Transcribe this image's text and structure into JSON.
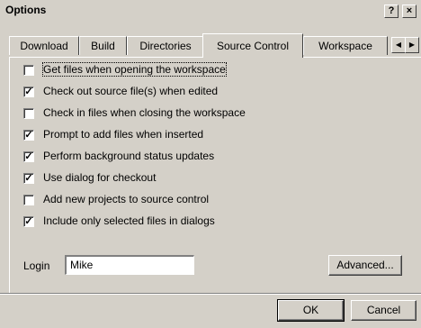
{
  "window": {
    "title": "Options"
  },
  "titlebar": {
    "help_label": "?",
    "close_label": "×"
  },
  "tabs": [
    {
      "label": "Download",
      "active": false
    },
    {
      "label": "Build",
      "active": false
    },
    {
      "label": "Directories",
      "active": false
    },
    {
      "label": "Source Control",
      "active": true
    },
    {
      "label": "Workspace",
      "active": false
    }
  ],
  "tab_scroll": {
    "left_icon": "◀",
    "right_icon": "▶"
  },
  "options": [
    {
      "label": "Get files when opening the workspace",
      "checked": false
    },
    {
      "label": "Check out source file(s) when edited",
      "checked": true
    },
    {
      "label": "Check in files when closing the workspace",
      "checked": false
    },
    {
      "label": "Prompt to add files when inserted",
      "checked": true
    },
    {
      "label": "Perform background status updates",
      "checked": true
    },
    {
      "label": "Use dialog for checkout",
      "checked": true
    },
    {
      "label": "Add new projects to source control",
      "checked": false
    },
    {
      "label": "Include only selected files in dialogs",
      "checked": true
    }
  ],
  "login": {
    "label": "Login",
    "value": "Mike"
  },
  "buttons": {
    "advanced": "Advanced...",
    "ok": "OK",
    "cancel": "Cancel"
  }
}
